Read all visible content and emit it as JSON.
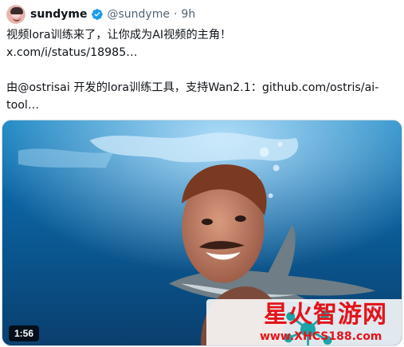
{
  "post": {
    "author_name": "sundyme",
    "handle": "@sundyme",
    "separator": "·",
    "time_ago": "9h",
    "lines": [
      "视频lora训练来了，让你成为AI视频的主角！",
      "x.com/i/status/18985…",
      "",
      "由@ostrisai 开发的lora训练工具，支持Wan2.1：github.com/ostris/ai-",
      "tool…"
    ]
  },
  "media": {
    "duration": "1:56",
    "watermark_title": "星火智游网",
    "watermark_url": "www.XHCS188.com"
  },
  "colors": {
    "verified": "#1d9bf0",
    "watermark_red": "#e3141b",
    "handle_gray": "#536471"
  },
  "icons": [
    "avatar",
    "verified-badge-icon",
    "logo-icon"
  ]
}
